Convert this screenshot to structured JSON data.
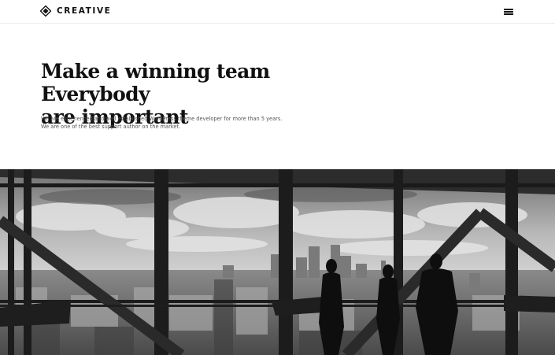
{
  "header": {
    "brand_name": "CREATIVE",
    "logo_icon": "diamond-logo-icon",
    "menu_icon": "hamburger-menu-icon"
  },
  "hero": {
    "title_line1": "Make a winning team Everybody",
    "title_line2": "are important",
    "text_line1": "We are experienced and well established WordPress theme developer for more than 5 years.",
    "text_line2": "We are one of the best support author on the market."
  },
  "image": {
    "description_icon": "office-window-city-photo"
  },
  "colors": {
    "text": "#111111",
    "muted": "#555555",
    "border": "#ececec"
  }
}
